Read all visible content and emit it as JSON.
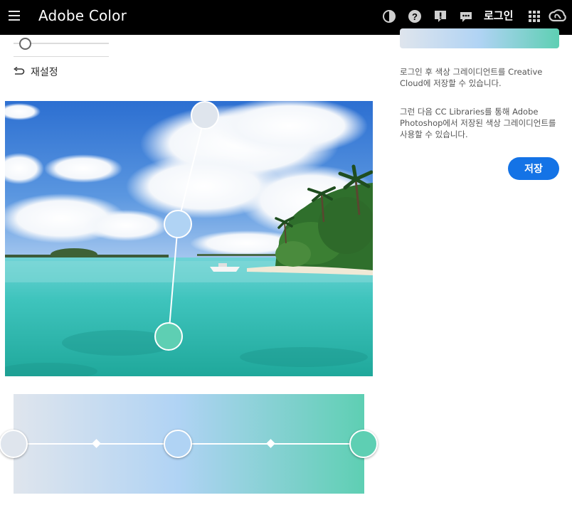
{
  "header": {
    "title": "Adobe Color",
    "login_label": "로그인",
    "icons": [
      "contrast-icon",
      "help-icon",
      "feedback-alert-icon",
      "chat-icon",
      "apps-grid-icon",
      "creative-cloud-icon"
    ]
  },
  "controls": {
    "reset_label": "재설정",
    "slider_value": 0.1
  },
  "photo": {
    "description_icon": "beach-photo",
    "picker_colors": [
      "#dfe5ed",
      "#b0d3f4",
      "#5ecfb3"
    ]
  },
  "gradient": {
    "stops": [
      "#dfe5ed",
      "#b0d3f4",
      "#5ecfb3"
    ],
    "stop_positions_pct": [
      0,
      47,
      100
    ],
    "midpoint_positions_pct": [
      23.5,
      73.5
    ]
  },
  "panel": {
    "info1": "로그인 후 색상 그레이디언트를 Creative Cloud에 저장할 수 있습니다.",
    "info2": "그런 다음 CC Libraries를 통해 Adobe Photoshop에서 저장된 색상 그레이디언트를 사용할 수 있습니다.",
    "save_label": "저장"
  }
}
